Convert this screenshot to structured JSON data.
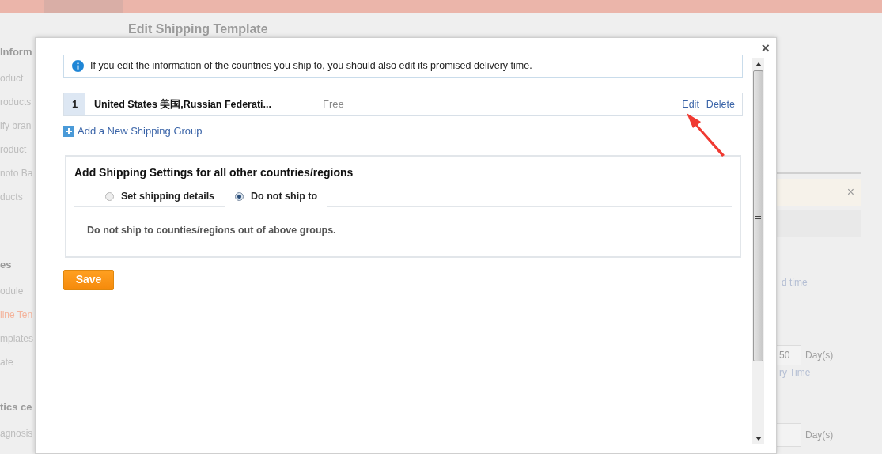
{
  "background": {
    "heading": "Edit Shipping Template",
    "sidebar": [
      {
        "heading": "Inform",
        "items": [
          {
            "label": "oduct",
            "selected": false
          },
          {
            "label": "roducts",
            "selected": false
          },
          {
            "label": "ify bran",
            "selected": false
          },
          {
            "label": "roduct",
            "selected": false
          },
          {
            "label": "noto Ba",
            "selected": false
          },
          {
            "label": "ducts",
            "selected": false
          }
        ]
      },
      {
        "heading": "es",
        "items": [
          {
            "label": "odule",
            "selected": false
          },
          {
            "label": "line Ten",
            "selected": true
          },
          {
            "label": "mplates",
            "selected": false
          },
          {
            "label": "ate",
            "selected": false
          }
        ]
      },
      {
        "heading": "tics ce",
        "items": [
          {
            "label": "agnosis",
            "selected": false
          }
        ]
      }
    ],
    "right_panel": {
      "banner_close": "×",
      "label_1": "d time",
      "days_value": "50",
      "unit_1": "Day(s)",
      "label_2": "ry Time",
      "unit_2": "Day(s)"
    }
  },
  "dialog": {
    "close": "×",
    "notice": "If you edit the information of the countries you ship to, you should also edit its promised delivery time.",
    "groups": [
      {
        "number": "1",
        "countries": "United States 美国,Russian Federati...",
        "cost": "Free",
        "actions": [
          "Edit",
          "Delete"
        ]
      }
    ],
    "add_group": "Add a New Shipping Group",
    "other_settings": {
      "title": "Add Shipping Settings for all other countries/regions",
      "options": [
        {
          "label": "Set shipping details",
          "selected": false
        },
        {
          "label": "Do not ship to",
          "selected": true
        }
      ],
      "message": "Do not ship to counties/regions out of above groups."
    },
    "save": "Save"
  }
}
